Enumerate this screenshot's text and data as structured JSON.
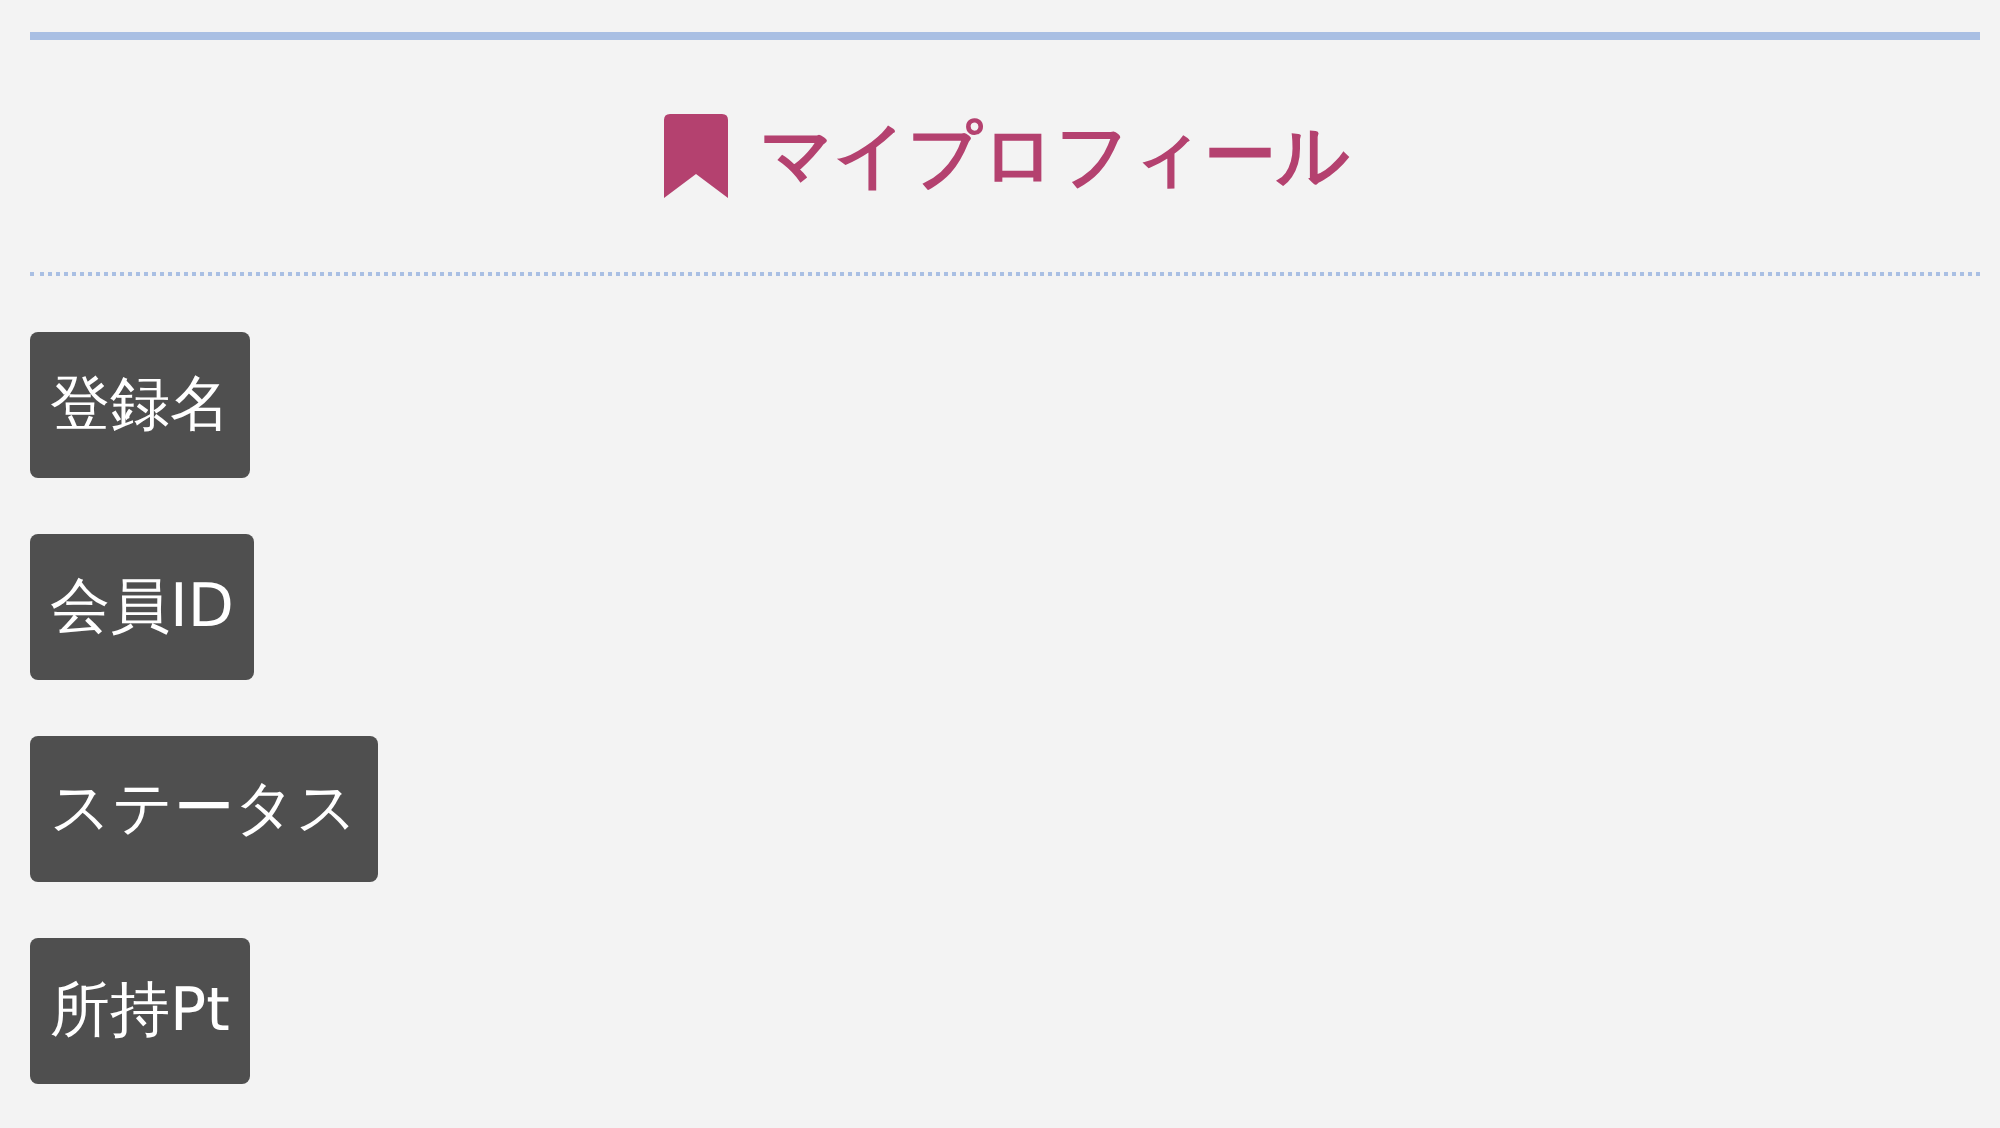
{
  "heading": {
    "title": "マイプロフィール"
  },
  "fields": [
    {
      "label": "登録名"
    },
    {
      "label": "会員ID"
    },
    {
      "label": "ステータス"
    },
    {
      "label": "所持Pt"
    }
  ]
}
